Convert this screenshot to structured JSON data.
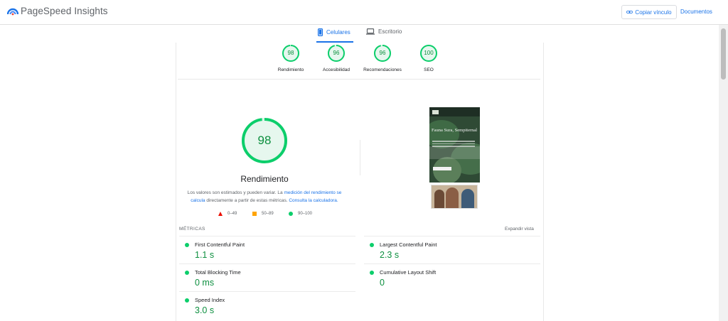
{
  "header": {
    "title": "PageSpeed Insights",
    "copy_label": "Copiar vínculo",
    "docs_label": "Documentos"
  },
  "tabs": [
    {
      "label": "Celulares",
      "active": true,
      "icon": "smartphone-icon"
    },
    {
      "label": "Escritorio",
      "active": false,
      "icon": "laptop-icon"
    }
  ],
  "scores": [
    {
      "value": "98",
      "label": "Rendimiento",
      "fraction": 0.98
    },
    {
      "value": "96",
      "label": "Accesibilidad",
      "fraction": 0.96
    },
    {
      "value": "96",
      "label": "Recomendaciones",
      "fraction": 0.96
    },
    {
      "value": "100",
      "label": "SEO",
      "fraction": 1.0
    }
  ],
  "performance": {
    "score": "98",
    "fraction": 0.98,
    "title": "Rendimiento",
    "desc_1": "Los valores son estimados y pueden variar. La ",
    "desc_link_1": "medición del rendimiento se calcula",
    "desc_2": " directamente a partir de estas métricas. ",
    "desc_link_2": "Consulta la calculadora."
  },
  "legend": [
    {
      "label": "0–49",
      "color": "#eb0f00"
    },
    {
      "label": "50–89",
      "color": "#ffa400"
    },
    {
      "label": "90–100",
      "color": "#0cce6b"
    }
  ],
  "screenshot": {
    "heading": "Fauna Sura, Sempiternal"
  },
  "metrics": {
    "title": "MÉTRICAS",
    "expand_label": "Expandir vista",
    "items": [
      {
        "name": "First Contentful Paint",
        "value": "1.1 s"
      },
      {
        "name": "Largest Contentful Paint",
        "value": "2.3 s"
      },
      {
        "name": "Total Blocking Time",
        "value": "0 ms"
      },
      {
        "name": "Cumulative Layout Shift",
        "value": "0"
      },
      {
        "name": "Speed Index",
        "value": "3.0 s"
      }
    ]
  },
  "colors": {
    "accent": "#1a73e8",
    "pass": "#0cce6b",
    "pass_text": "#0d8f3f"
  }
}
